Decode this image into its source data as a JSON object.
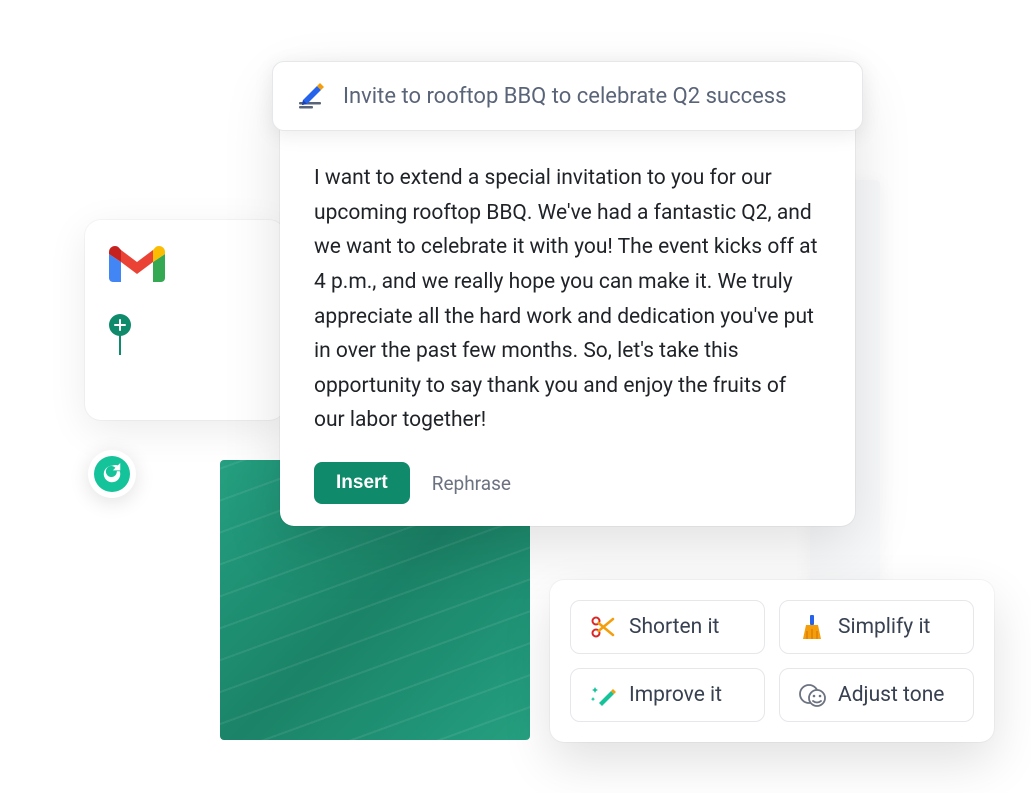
{
  "prompt": {
    "text": "Invite to rooftop BBQ to celebrate Q2 success",
    "icon": "compose-pen-icon"
  },
  "body": "I want to extend a special invitation to you for our upcoming rooftop BBQ. We've had a fantastic Q2, and we want to celebrate it with you! The event kicks off at 4 p.m., and we really hope you can make it. We truly appreciate all the hard work and dedication you've put in over the past few months. So, let's take this opportunity to say thank you and enjoy the fruits of our labor together!",
  "actions": {
    "insert": "Insert",
    "rephrase": "Rephrase"
  },
  "chips": [
    {
      "label": "Shorten it",
      "icon": "scissors-icon"
    },
    {
      "label": "Simplify it",
      "icon": "broom-icon"
    },
    {
      "label": "Improve it",
      "icon": "sparkle-pencil-icon"
    },
    {
      "label": "Adjust tone",
      "icon": "face-mood-icon"
    }
  ],
  "sidebar": {
    "app": "Gmail",
    "addAction": "add"
  },
  "badge": {
    "name": "Grammarly"
  },
  "colors": {
    "accent": "#0f8a6a",
    "teal": "#15c39a",
    "text": "#1f2328",
    "muted": "#6b7280"
  }
}
